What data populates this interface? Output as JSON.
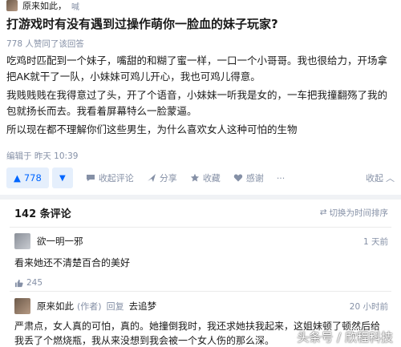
{
  "top": {
    "author_name": "原来如此，",
    "author_sig": "喊"
  },
  "question": {
    "title": "打游戏时有没有遇到过操作萌你一脸血的妹子玩家?",
    "meta": "778 人赞同了该回答"
  },
  "answer": {
    "p1": "吃鸡时匹配到一个妹子，嘴甜的和糊了蜜一样，一口一个小哥哥。我也很给力，开场拿把AK就干了一队，小妹妹可鸡儿开心，我也可鸡儿得意。",
    "p2": "我贱贱贱在我得意过了头，开了个语音，小妹妹一听我是女的，一车把我撞翻殇了我的包就扬长而去。我看着屏幕特么一脸蒙逼。",
    "p3": "所以现在都不理解你们这些男生，为什么喜欢女人这种可怕的生物",
    "edited": "编辑于 昨天 10:39"
  },
  "actions": {
    "vote_count": "778",
    "vote_up_icon": "triangle-up-icon",
    "vote_down_icon": "triangle-down-icon",
    "collapse_comments": "收起评论",
    "share": "分享",
    "favorite": "收藏",
    "thanks": "感谢",
    "collapse": "收起"
  },
  "comments": {
    "count": "142 条评论",
    "sort_toggle": "切换为时间排序",
    "items": [
      {
        "name": "欲一明一邪",
        "time": "1 天前",
        "text": "看来她还不清楚百合的美好",
        "likes": "245"
      },
      {
        "name": "原来如此",
        "author_tag": "(作者)",
        "reply": "回复",
        "target": "去追梦",
        "time": "20 小时前",
        "text": "严肃点，女人真的可怕，真的。她撞倒我时，我还求她扶我起来，这姐妹顿了顿然后给我丢了个燃烧瓶，我从来没想到我会被一个女人伤的那么深。"
      }
    ]
  },
  "watermark": "头条号 / 欣程科技",
  "colors": {
    "accent": "#0066ff",
    "muted": "#8590a6",
    "vote_bg": "#e5effc"
  }
}
